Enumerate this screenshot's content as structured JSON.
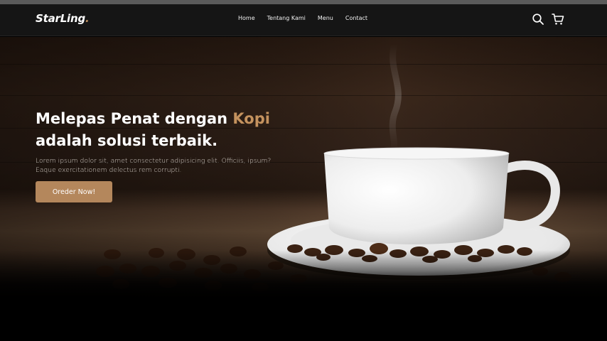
{
  "brand": {
    "logo_main": "StarLing",
    "logo_accent": "."
  },
  "nav": {
    "links": [
      "Home",
      "Tentang Kami",
      "Menu",
      "Contact"
    ],
    "icons": [
      "search-icon",
      "cart-icon"
    ]
  },
  "hero": {
    "title_part1": "Melepas Penat dengan ",
    "title_highlight": "Kopi",
    "title_part2": "adalah solusi terbaik.",
    "description": "Lorem ipsum dolor sit, amet consectetur adipisicing elit. Officiis, ipsum? Eaque exercitationem delectus rem corrupti.",
    "cta_label": "Oreder Now!"
  },
  "colors": {
    "accent": "#b6895b",
    "navbar": "#151515",
    "cta": "#b4875c"
  }
}
